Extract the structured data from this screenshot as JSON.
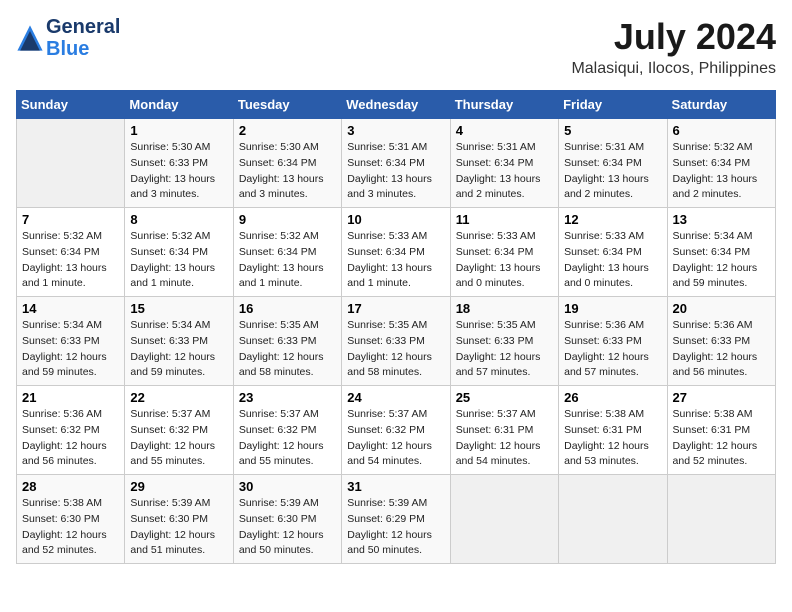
{
  "header": {
    "logo_line1": "General",
    "logo_line2": "Blue",
    "main_title": "July 2024",
    "subtitle": "Malasiqui, Ilocos, Philippines"
  },
  "days_of_week": [
    "Sunday",
    "Monday",
    "Tuesday",
    "Wednesday",
    "Thursday",
    "Friday",
    "Saturday"
  ],
  "weeks": [
    [
      {
        "day": "",
        "info": ""
      },
      {
        "day": "1",
        "info": "Sunrise: 5:30 AM\nSunset: 6:33 PM\nDaylight: 13 hours\nand 3 minutes."
      },
      {
        "day": "2",
        "info": "Sunrise: 5:30 AM\nSunset: 6:34 PM\nDaylight: 13 hours\nand 3 minutes."
      },
      {
        "day": "3",
        "info": "Sunrise: 5:31 AM\nSunset: 6:34 PM\nDaylight: 13 hours\nand 3 minutes."
      },
      {
        "day": "4",
        "info": "Sunrise: 5:31 AM\nSunset: 6:34 PM\nDaylight: 13 hours\nand 2 minutes."
      },
      {
        "day": "5",
        "info": "Sunrise: 5:31 AM\nSunset: 6:34 PM\nDaylight: 13 hours\nand 2 minutes."
      },
      {
        "day": "6",
        "info": "Sunrise: 5:32 AM\nSunset: 6:34 PM\nDaylight: 13 hours\nand 2 minutes."
      }
    ],
    [
      {
        "day": "7",
        "info": "Sunrise: 5:32 AM\nSunset: 6:34 PM\nDaylight: 13 hours\nand 1 minute."
      },
      {
        "day": "8",
        "info": "Sunrise: 5:32 AM\nSunset: 6:34 PM\nDaylight: 13 hours\nand 1 minute."
      },
      {
        "day": "9",
        "info": "Sunrise: 5:32 AM\nSunset: 6:34 PM\nDaylight: 13 hours\nand 1 minute."
      },
      {
        "day": "10",
        "info": "Sunrise: 5:33 AM\nSunset: 6:34 PM\nDaylight: 13 hours\nand 1 minute."
      },
      {
        "day": "11",
        "info": "Sunrise: 5:33 AM\nSunset: 6:34 PM\nDaylight: 13 hours\nand 0 minutes."
      },
      {
        "day": "12",
        "info": "Sunrise: 5:33 AM\nSunset: 6:34 PM\nDaylight: 13 hours\nand 0 minutes."
      },
      {
        "day": "13",
        "info": "Sunrise: 5:34 AM\nSunset: 6:34 PM\nDaylight: 12 hours\nand 59 minutes."
      }
    ],
    [
      {
        "day": "14",
        "info": "Sunrise: 5:34 AM\nSunset: 6:33 PM\nDaylight: 12 hours\nand 59 minutes."
      },
      {
        "day": "15",
        "info": "Sunrise: 5:34 AM\nSunset: 6:33 PM\nDaylight: 12 hours\nand 59 minutes."
      },
      {
        "day": "16",
        "info": "Sunrise: 5:35 AM\nSunset: 6:33 PM\nDaylight: 12 hours\nand 58 minutes."
      },
      {
        "day": "17",
        "info": "Sunrise: 5:35 AM\nSunset: 6:33 PM\nDaylight: 12 hours\nand 58 minutes."
      },
      {
        "day": "18",
        "info": "Sunrise: 5:35 AM\nSunset: 6:33 PM\nDaylight: 12 hours\nand 57 minutes."
      },
      {
        "day": "19",
        "info": "Sunrise: 5:36 AM\nSunset: 6:33 PM\nDaylight: 12 hours\nand 57 minutes."
      },
      {
        "day": "20",
        "info": "Sunrise: 5:36 AM\nSunset: 6:33 PM\nDaylight: 12 hours\nand 56 minutes."
      }
    ],
    [
      {
        "day": "21",
        "info": "Sunrise: 5:36 AM\nSunset: 6:32 PM\nDaylight: 12 hours\nand 56 minutes."
      },
      {
        "day": "22",
        "info": "Sunrise: 5:37 AM\nSunset: 6:32 PM\nDaylight: 12 hours\nand 55 minutes."
      },
      {
        "day": "23",
        "info": "Sunrise: 5:37 AM\nSunset: 6:32 PM\nDaylight: 12 hours\nand 55 minutes."
      },
      {
        "day": "24",
        "info": "Sunrise: 5:37 AM\nSunset: 6:32 PM\nDaylight: 12 hours\nand 54 minutes."
      },
      {
        "day": "25",
        "info": "Sunrise: 5:37 AM\nSunset: 6:31 PM\nDaylight: 12 hours\nand 54 minutes."
      },
      {
        "day": "26",
        "info": "Sunrise: 5:38 AM\nSunset: 6:31 PM\nDaylight: 12 hours\nand 53 minutes."
      },
      {
        "day": "27",
        "info": "Sunrise: 5:38 AM\nSunset: 6:31 PM\nDaylight: 12 hours\nand 52 minutes."
      }
    ],
    [
      {
        "day": "28",
        "info": "Sunrise: 5:38 AM\nSunset: 6:30 PM\nDaylight: 12 hours\nand 52 minutes."
      },
      {
        "day": "29",
        "info": "Sunrise: 5:39 AM\nSunset: 6:30 PM\nDaylight: 12 hours\nand 51 minutes."
      },
      {
        "day": "30",
        "info": "Sunrise: 5:39 AM\nSunset: 6:30 PM\nDaylight: 12 hours\nand 50 minutes."
      },
      {
        "day": "31",
        "info": "Sunrise: 5:39 AM\nSunset: 6:29 PM\nDaylight: 12 hours\nand 50 minutes."
      },
      {
        "day": "",
        "info": ""
      },
      {
        "day": "",
        "info": ""
      },
      {
        "day": "",
        "info": ""
      }
    ]
  ]
}
